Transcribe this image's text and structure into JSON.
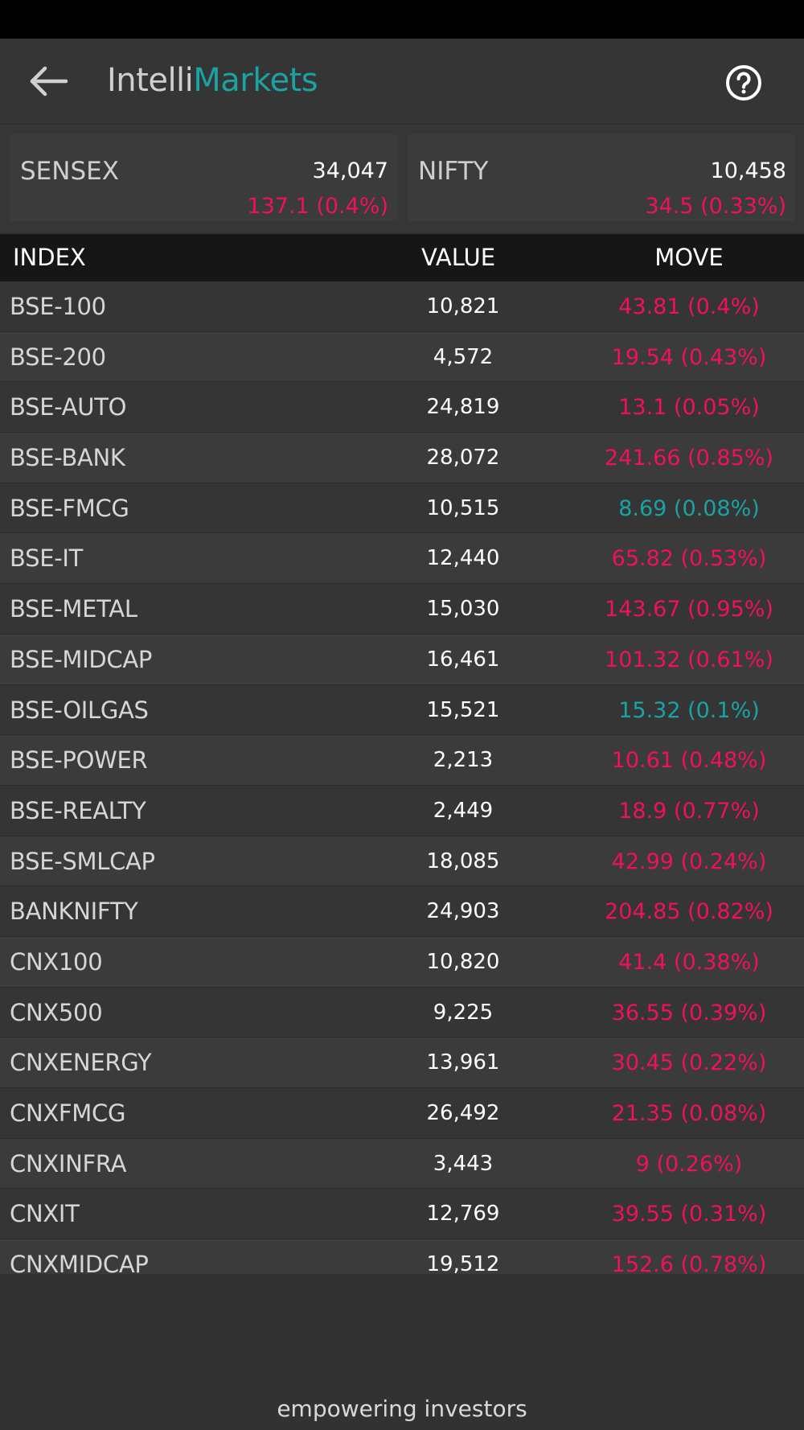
{
  "app": {
    "logo_part1": "Intelli",
    "logo_part2": "Markets",
    "accent_color": "#1aa3a3",
    "negative_color": "#f0115a",
    "back_icon": "arrow-left-icon",
    "help_icon": "question-circle-icon"
  },
  "summary": {
    "sensex": {
      "name": "SENSEX",
      "value": "34,047",
      "move": "137.1 (0.4%)"
    },
    "nifty": {
      "name": "NIFTY",
      "value": "10,458",
      "move": "34.5 (0.33%)"
    }
  },
  "table": {
    "headers": {
      "index": "INDEX",
      "value": "VALUE",
      "move": "MOVE"
    },
    "rows": [
      {
        "index": "BSE-100",
        "value": "10,821",
        "move": "43.81 (0.4%)",
        "dir": "neg"
      },
      {
        "index": "BSE-200",
        "value": "4,572",
        "move": "19.54 (0.43%)",
        "dir": "neg"
      },
      {
        "index": "BSE-AUTO",
        "value": "24,819",
        "move": "13.1 (0.05%)",
        "dir": "neg"
      },
      {
        "index": "BSE-BANK",
        "value": "28,072",
        "move": "241.66 (0.85%)",
        "dir": "neg"
      },
      {
        "index": "BSE-FMCG",
        "value": "10,515",
        "move": "8.69 (0.08%)",
        "dir": "pos"
      },
      {
        "index": "BSE-IT",
        "value": "12,440",
        "move": "65.82 (0.53%)",
        "dir": "neg"
      },
      {
        "index": "BSE-METAL",
        "value": "15,030",
        "move": "143.67 (0.95%)",
        "dir": "neg"
      },
      {
        "index": "BSE-MIDCAP",
        "value": "16,461",
        "move": "101.32 (0.61%)",
        "dir": "neg"
      },
      {
        "index": "BSE-OILGAS",
        "value": "15,521",
        "move": "15.32 (0.1%)",
        "dir": "pos"
      },
      {
        "index": "BSE-POWER",
        "value": "2,213",
        "move": "10.61 (0.48%)",
        "dir": "neg"
      },
      {
        "index": "BSE-REALTY",
        "value": "2,449",
        "move": "18.9 (0.77%)",
        "dir": "neg"
      },
      {
        "index": "BSE-SMLCAP",
        "value": "18,085",
        "move": "42.99 (0.24%)",
        "dir": "neg"
      },
      {
        "index": "BANKNIFTY",
        "value": "24,903",
        "move": "204.85 (0.82%)",
        "dir": "neg"
      },
      {
        "index": "CNX100",
        "value": "10,820",
        "move": "41.4 (0.38%)",
        "dir": "neg"
      },
      {
        "index": "CNX500",
        "value": "9,225",
        "move": "36.55 (0.39%)",
        "dir": "neg"
      },
      {
        "index": "CNXENERGY",
        "value": "13,961",
        "move": "30.45 (0.22%)",
        "dir": "neg"
      },
      {
        "index": "CNXFMCG",
        "value": "26,492",
        "move": "21.35 (0.08%)",
        "dir": "neg"
      },
      {
        "index": "CNXINFRA",
        "value": "3,443",
        "move": "9 (0.26%)",
        "dir": "neg"
      },
      {
        "index": "CNXIT",
        "value": "12,769",
        "move": "39.55 (0.31%)",
        "dir": "neg"
      },
      {
        "index": "CNXMIDCAP",
        "value": "19,512",
        "move": "152.6 (0.78%)",
        "dir": "neg"
      }
    ]
  },
  "footer": {
    "tagline": "empowering investors"
  }
}
